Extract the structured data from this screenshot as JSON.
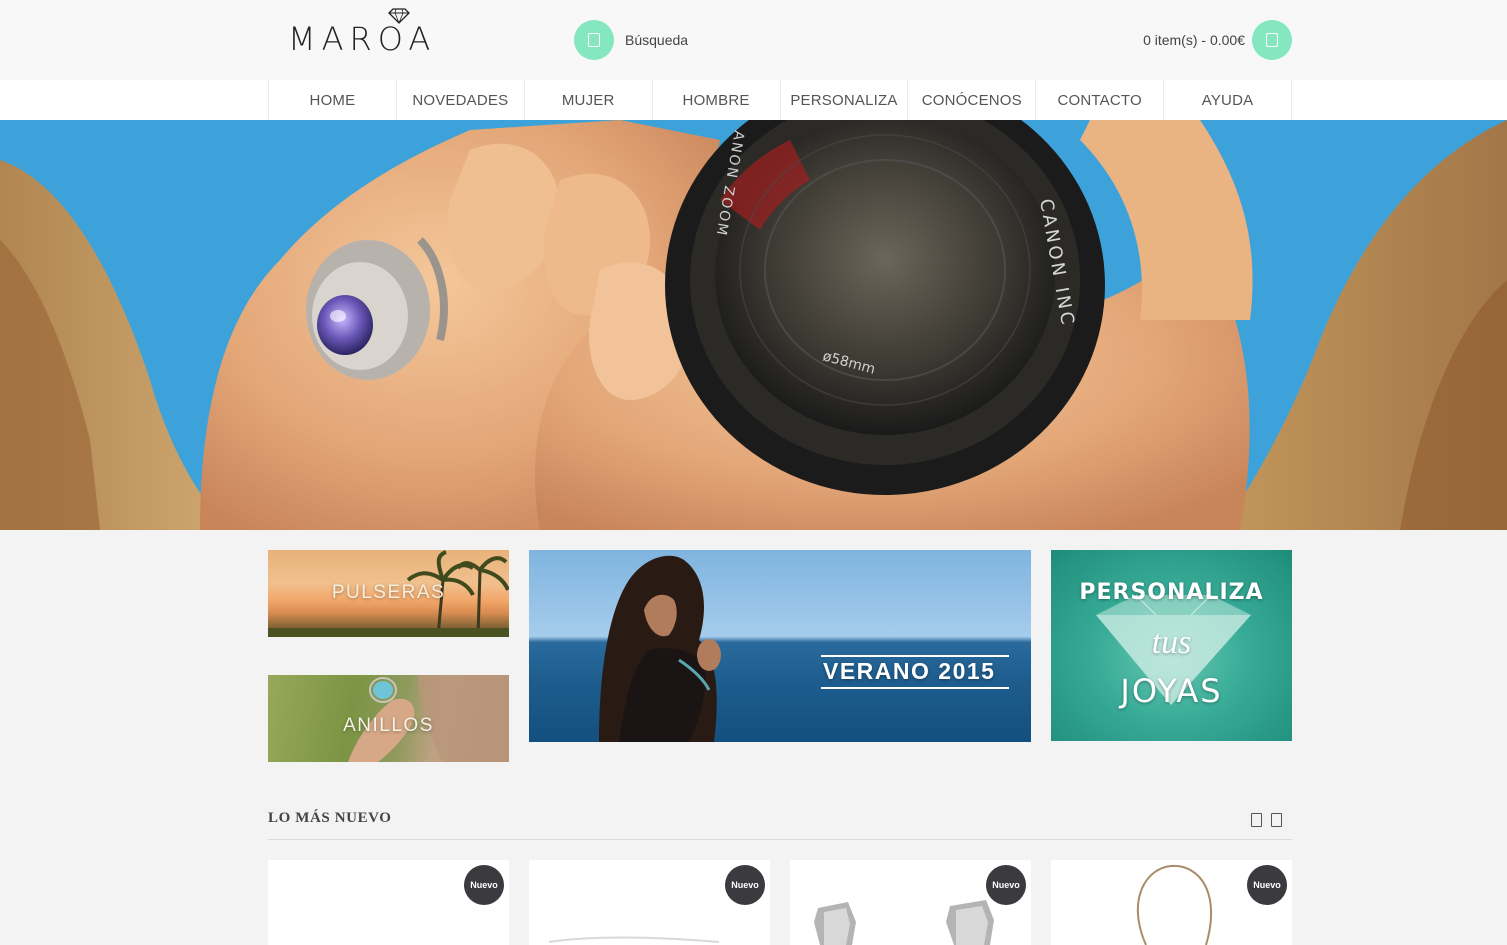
{
  "header": {
    "logo_text": "MAROA",
    "search_label": "Búsqueda",
    "cart_summary": "0 item(s) - 0.00€",
    "accent_color": "#84e7bf"
  },
  "nav": {
    "items": [
      {
        "label": "HOME"
      },
      {
        "label": "NOVEDADES"
      },
      {
        "label": "MUJER"
      },
      {
        "label": "HOMBRE"
      },
      {
        "label": "PERSONALIZA"
      },
      {
        "label": "CONÓCENOS"
      },
      {
        "label": "CONTACTO"
      },
      {
        "label": "AYUDA"
      }
    ]
  },
  "hero": {
    "lens_text_1": "CANON INC",
    "lens_text_2": "ANON ZOOM",
    "lens_text_3": "ø58mm"
  },
  "banners": {
    "pulseras": "PULSERAS",
    "anillos": "ANILLOS",
    "verano": "VERANO 2015",
    "personaliza_line1": "PERSONALIZA",
    "personaliza_line2": "tus",
    "personaliza_line3": "JOYAS"
  },
  "new_section": {
    "title": "LO MÁS NUEVO",
    "products": [
      {
        "badge": "Nuevo"
      },
      {
        "badge": "Nuevo"
      },
      {
        "badge": "Nuevo"
      },
      {
        "badge": "Nuevo"
      }
    ]
  }
}
